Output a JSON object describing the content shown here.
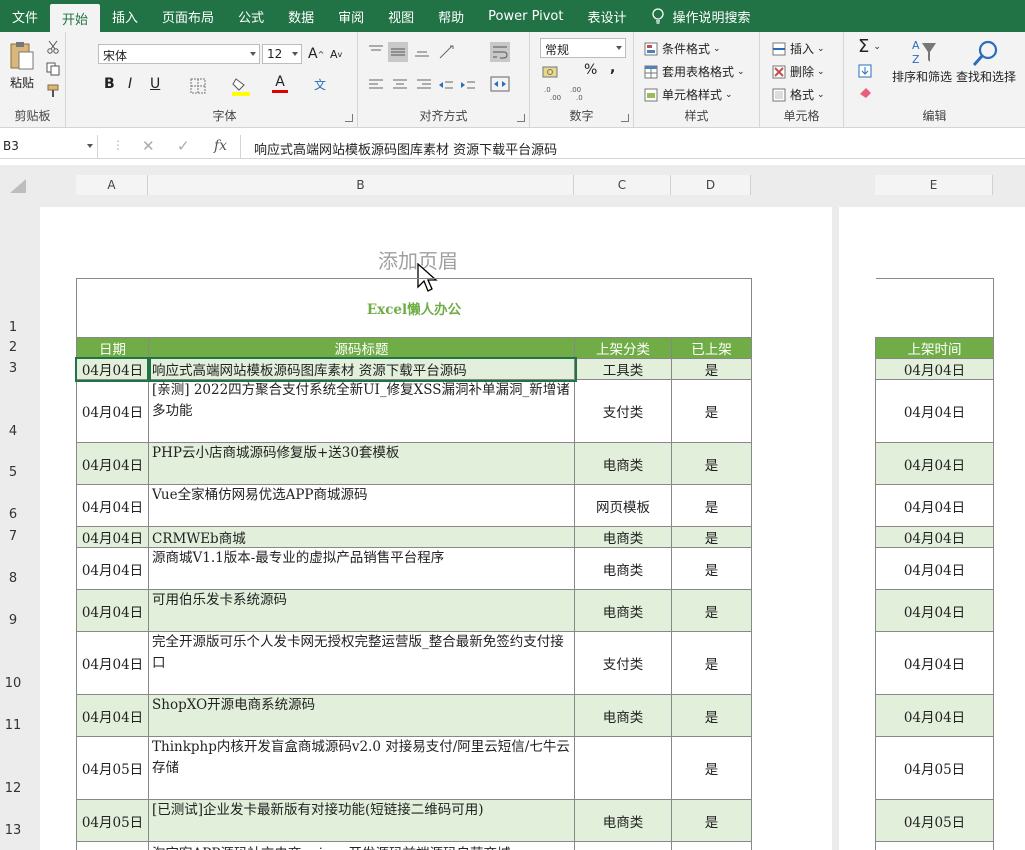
{
  "ribbon_tabs": [
    {
      "label": "文件",
      "active": false
    },
    {
      "label": "开始",
      "active": true
    },
    {
      "label": "插入",
      "active": false
    },
    {
      "label": "页面布局",
      "active": false
    },
    {
      "label": "公式",
      "active": false
    },
    {
      "label": "数据",
      "active": false
    },
    {
      "label": "审阅",
      "active": false
    },
    {
      "label": "视图",
      "active": false
    },
    {
      "label": "帮助",
      "active": false
    },
    {
      "label": "Power Pivot",
      "active": false
    },
    {
      "label": "表设计",
      "active": false
    }
  ],
  "tell_me": "操作说明搜索",
  "clipboard": {
    "paste_label": "粘贴",
    "group_label": "剪贴板"
  },
  "font": {
    "name": "宋体",
    "size": "12",
    "group_label": "字体",
    "grow": "A",
    "shrink": "A",
    "bold": "B",
    "italic": "I",
    "underline": "U",
    "font_color_glyph": "A",
    "phonetic_glyph": "文"
  },
  "alignment": {
    "group_label": "对齐方式"
  },
  "number": {
    "format": "常规",
    "group_label": "数字",
    "percent": "%",
    "comma": ","
  },
  "styles": {
    "conditional": "条件格式",
    "table": "套用表格格式",
    "cell": "单元格样式",
    "group_label": "样式"
  },
  "cells": {
    "insert": "插入",
    "delete": "删除",
    "format": "格式",
    "group_label": "单元格"
  },
  "editing": {
    "sort_filter": "排序和筛选",
    "find_select": "查找和选择",
    "group_label": "编辑",
    "sum": "Σ"
  },
  "formula_bar": {
    "cell_ref": "B3",
    "fx": "fx",
    "content": "响应式高端网站模板源码图库素材 资源下载平台源码"
  },
  "column_headers": [
    "A",
    "B",
    "C",
    "D",
    "E"
  ],
  "page_header_placeholder": "添加页眉",
  "sheet_title": "Excel懒人办公",
  "table_headers": {
    "date": "日期",
    "title": "源码标题",
    "category": "上架分类",
    "listed": "已上架",
    "list_time": "上架时间"
  },
  "rows": [
    {
      "num": "3",
      "date": "04月04日",
      "title": "响应式高端网站模板源码图库素材 资源下载平台源码",
      "category": "工具类",
      "listed": "是",
      "list_time": "04月04日"
    },
    {
      "num": "4",
      "date": "04月04日",
      "title": "[亲测] 2022四方聚合支付系统全新UI_修复XSS漏洞补单漏洞_新增诸多功能",
      "category": "支付类",
      "listed": "是",
      "list_time": "04月04日"
    },
    {
      "num": "5",
      "date": "04月04日",
      "title": "PHP云小店商城源码修复版+送30套模板",
      "category": "电商类",
      "listed": "是",
      "list_time": "04月04日"
    },
    {
      "num": "6",
      "date": "04月04日",
      "title": "Vue全家桶仿网易优选APP商城源码",
      "category": "网页模板",
      "listed": "是",
      "list_time": "04月04日"
    },
    {
      "num": "7",
      "date": "04月04日",
      "title": "CRMWEb商城",
      "category": "电商类",
      "listed": "是",
      "list_time": "04月04日"
    },
    {
      "num": "8",
      "date": "04月04日",
      "title": "源商城V1.1版本-最专业的虚拟产品销售平台程序",
      "category": "电商类",
      "listed": "是",
      "list_time": "04月04日"
    },
    {
      "num": "9",
      "date": "04月04日",
      "title": "可用伯乐发卡系统源码",
      "category": "电商类",
      "listed": "是",
      "list_time": "04月04日"
    },
    {
      "num": "10",
      "date": "04月04日",
      "title": "完全开源版可乐个人发卡网无授权完整运营版_整合最新免签约支付接口",
      "category": "支付类",
      "listed": "是",
      "list_time": "04月04日"
    },
    {
      "num": "11",
      "date": "04月04日",
      "title": "ShopXO开源电商系统源码",
      "category": "电商类",
      "listed": "是",
      "list_time": "04月04日"
    },
    {
      "num": "12",
      "date": "04月05日",
      "title": "Thinkphp内核开发盲盒商城源码v2.0 对接易支付/阿里云短信/七牛云存储",
      "category": "",
      "listed": "是",
      "list_time": "04月05日"
    },
    {
      "num": "13",
      "date": "04月05日",
      "title": "[已测试]企业发卡最新版有对接功能(短链接二维码可用)",
      "category": "电商类",
      "listed": "是",
      "list_time": "04月05日"
    }
  ],
  "row_numbers_top": [
    "1",
    "2"
  ],
  "partial_bottom_text": "淘宝客APP源码社交电商uniapp开发源码前端源码自营商城"
}
